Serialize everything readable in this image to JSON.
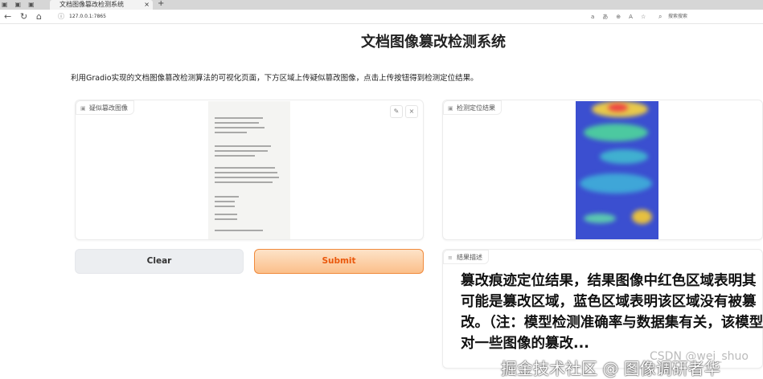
{
  "browser": {
    "tab_title": "文档图像篡改检测系统",
    "url": "127.0.0.1:7865",
    "search_placeholder": "搜索搜索"
  },
  "page": {
    "title": "文档图像篡改检测系统",
    "description": "利用Gradio实现的文档图像篡改检测算法的可视化页面，下方区域上传疑似篡改图像，点击上传按钮得到检测定位结果。"
  },
  "input_panel": {
    "label": "疑似篡改图像"
  },
  "output_panel": {
    "label": "检测定位结果"
  },
  "buttons": {
    "clear": "Clear",
    "submit": "Submit"
  },
  "result": {
    "label": "结果描述",
    "text": "篡改痕迹定位结果，结果图像中红色区域表明其可能是篡改区域，蓝色区域表明该区域没有被篡改。（注：模型检测准确率与数据集有关，该模型对一些图像的篡改..."
  },
  "watermark": {
    "text": "掘金技术社区 @ 图像调研者华",
    "csdn": "CSDN @wei_shuo"
  }
}
